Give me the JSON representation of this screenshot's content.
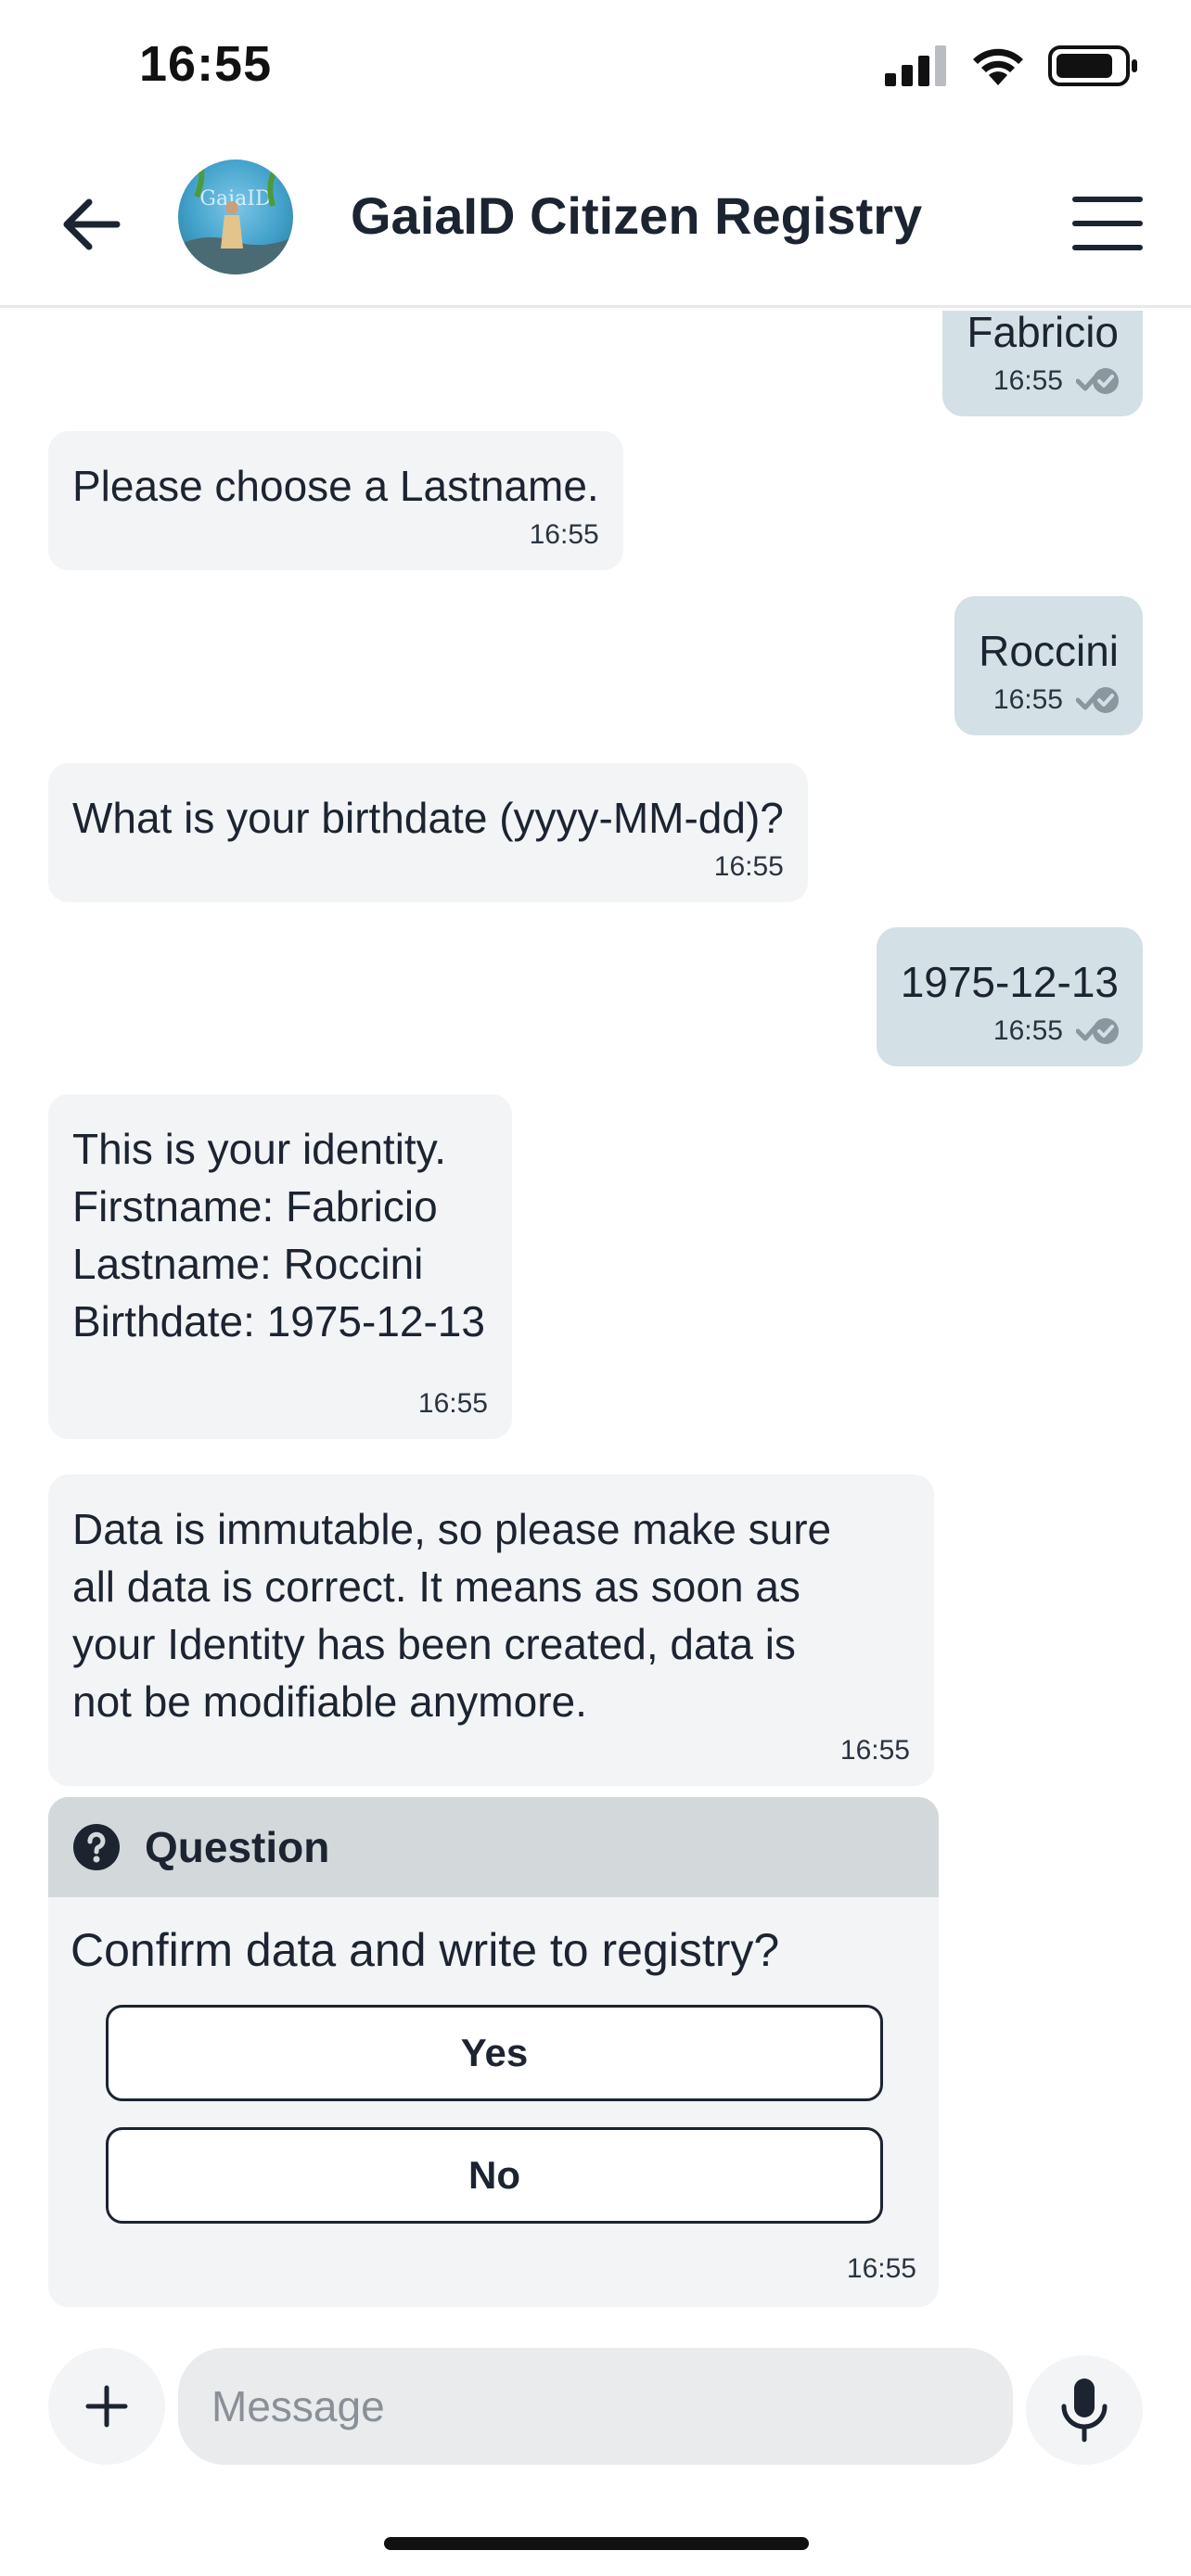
{
  "status_bar": {
    "time": "16:55"
  },
  "header": {
    "title": "GaiaID Citizen Registry",
    "avatar_text": "GaiaID"
  },
  "messages": [
    {
      "direction": "out",
      "text": "Fabricio",
      "time": "16:55"
    },
    {
      "direction": "in",
      "text": "Please choose a Lastname.",
      "time": "16:55"
    },
    {
      "direction": "out",
      "text": "Roccini",
      "time": "16:55"
    },
    {
      "direction": "in",
      "text": "What is your birthdate (yyyy-MM-dd)?",
      "time": "16:55"
    },
    {
      "direction": "out",
      "text": "1975-12-13",
      "time": "16:55"
    },
    {
      "direction": "in",
      "text": "This is your identity.\nFirstname: Fabricio\nLastname: Roccini\nBirthdate: 1975-12-13",
      "time": "16:55"
    },
    {
      "direction": "in",
      "text": "Data is immutable, so please make sure\nall data is correct. It means as soon as\nyour Identity has been created, data is\nnot be modifiable anymore.",
      "time": "16:55"
    }
  ],
  "question": {
    "label": "Question",
    "text": "Confirm data and write to registry?",
    "options": [
      "Yes",
      "No"
    ],
    "time": "16:55"
  },
  "composer": {
    "placeholder": "Message"
  },
  "colors": {
    "incoming_bubble": "#f3f4f6",
    "outgoing_bubble": "#d3e0e5",
    "question_header": "#d3d8db",
    "text": "#1c2431"
  }
}
